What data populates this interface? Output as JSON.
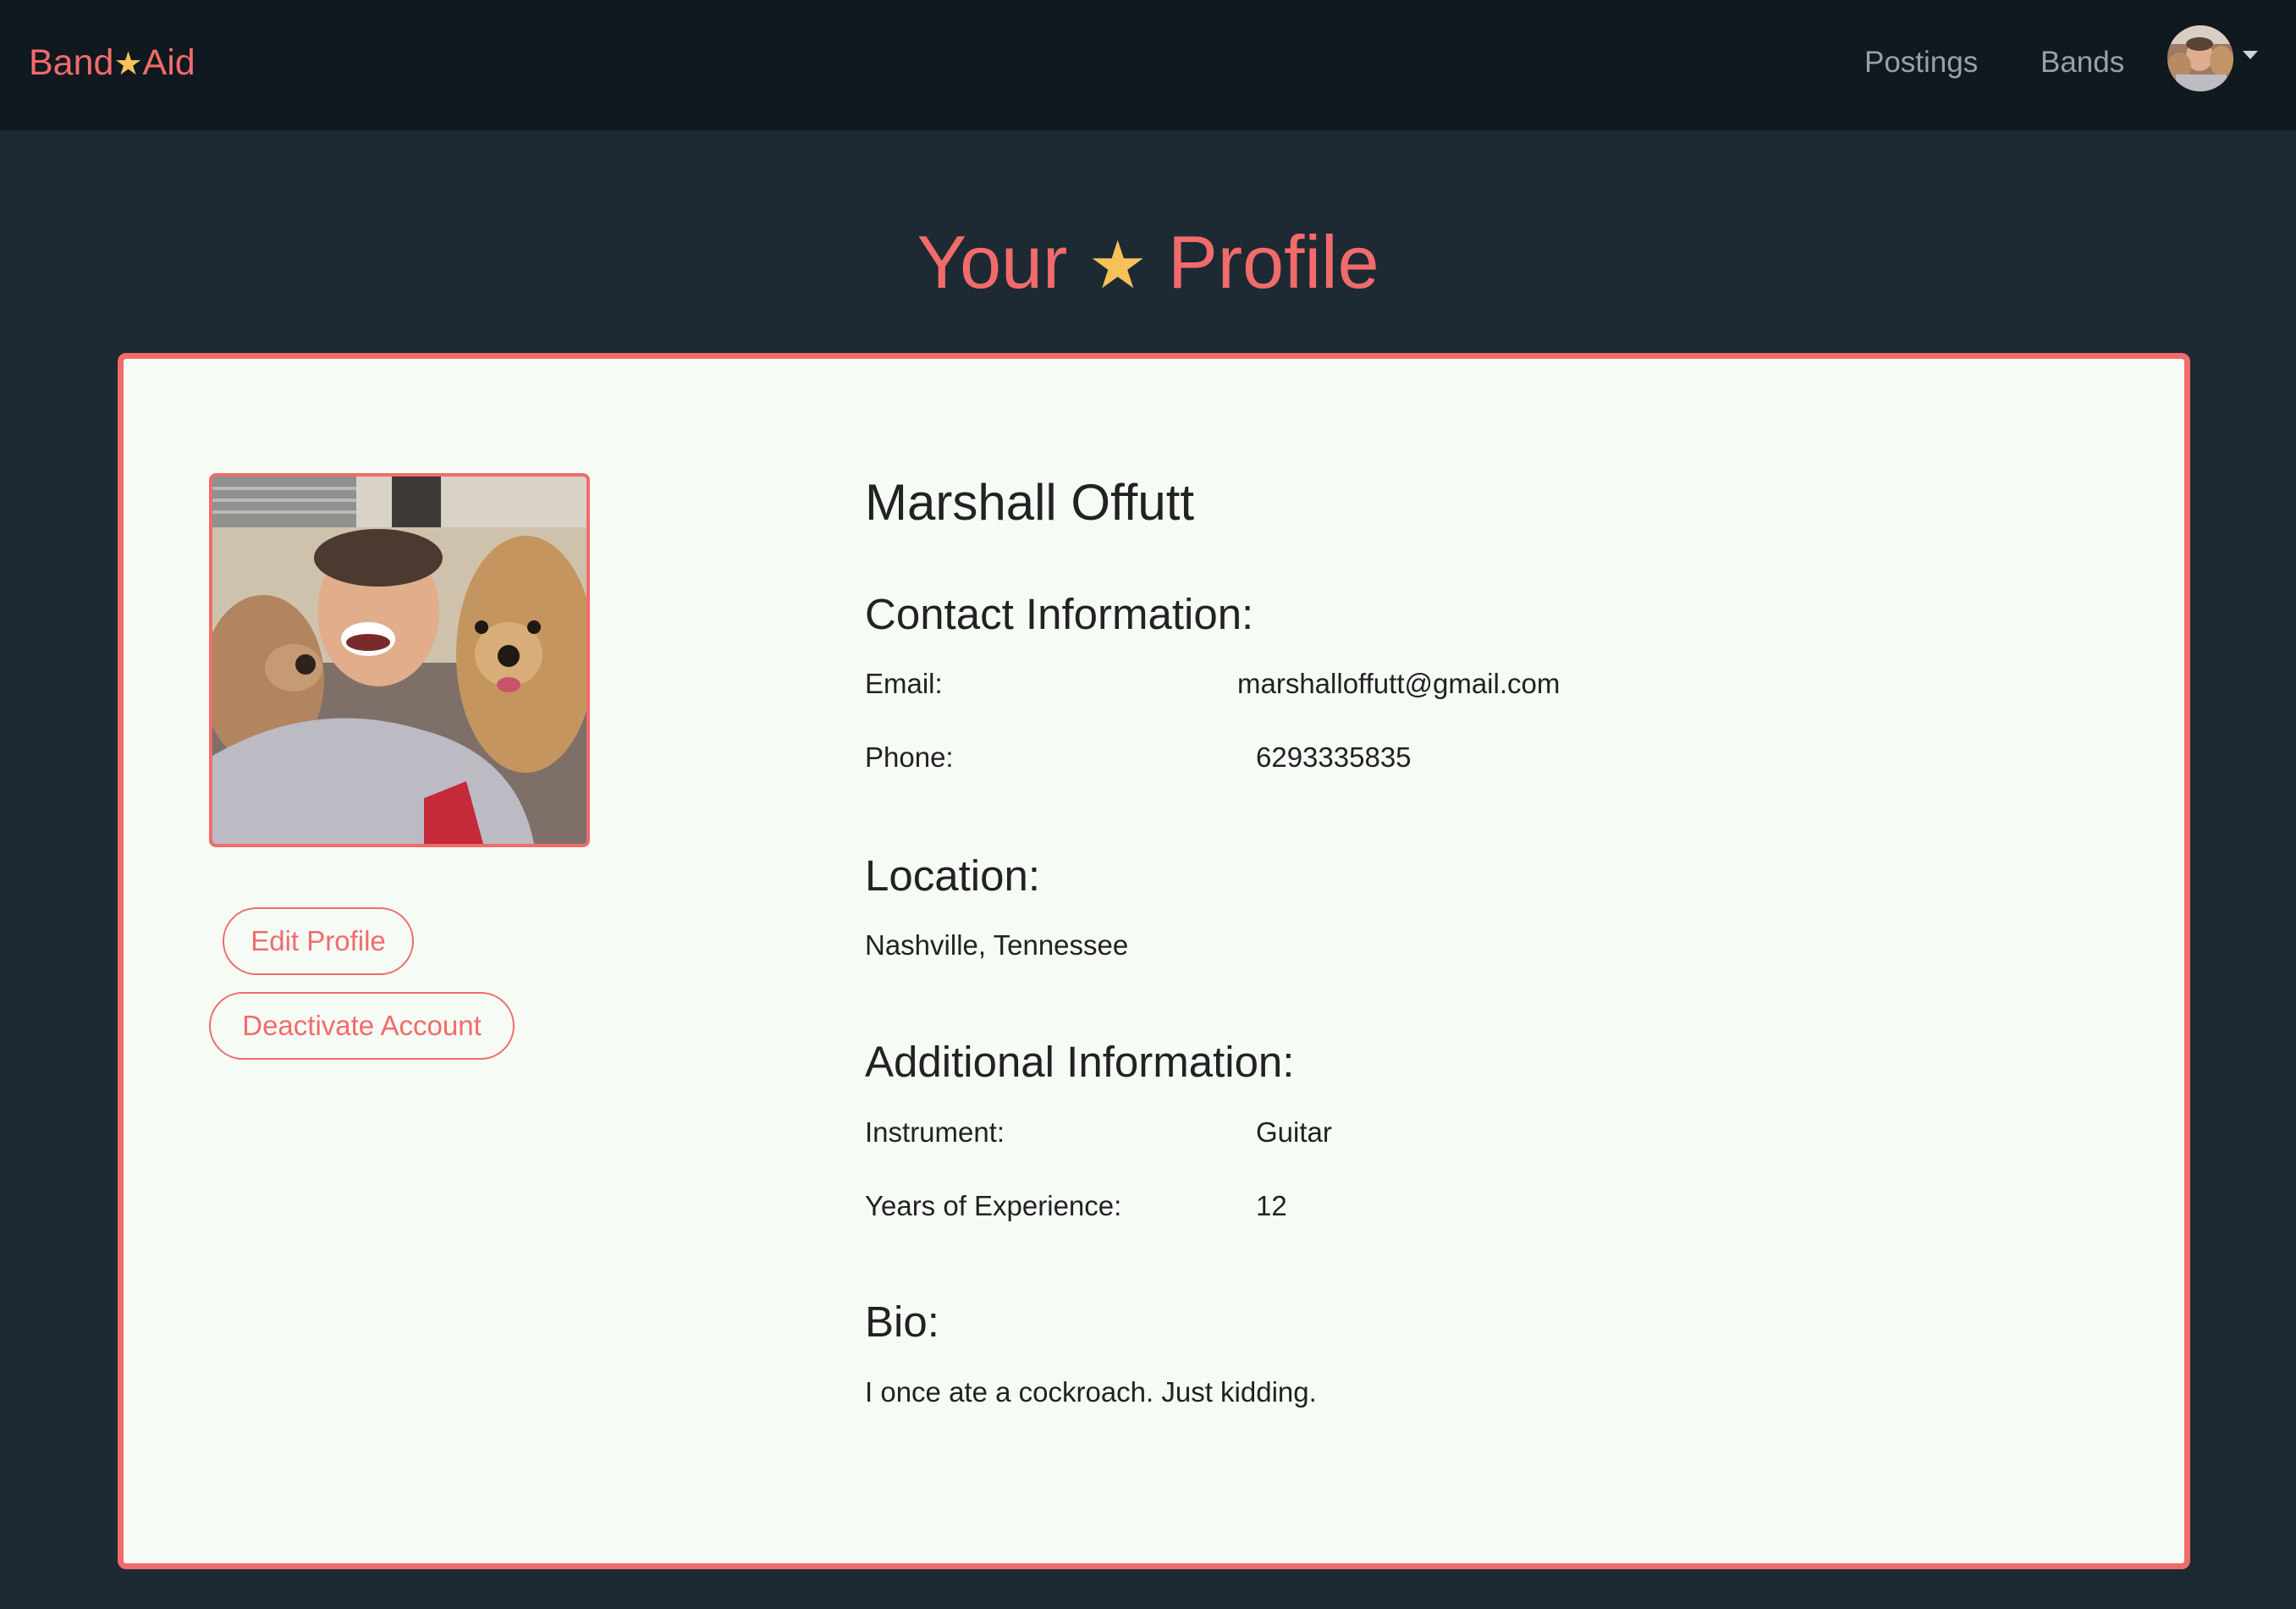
{
  "nav": {
    "brand_left": "Band",
    "brand_star": "★",
    "brand_right": "Aid",
    "links": [
      "Postings",
      "Bands"
    ]
  },
  "page": {
    "title_left": "Your",
    "title_star": "★",
    "title_right": "Profile"
  },
  "profile": {
    "name": "Marshall Offutt",
    "buttons": {
      "edit": "Edit Profile",
      "deactivate": "Deactivate Account"
    },
    "contact": {
      "heading": "Contact Information:",
      "email_label": "Email:",
      "email_value": "marshalloffutt@gmail.com",
      "phone_label": "Phone:",
      "phone_value": "6293335835"
    },
    "location": {
      "heading": "Location:",
      "value": "Nashville, Tennessee"
    },
    "additional": {
      "heading": "Additional Information:",
      "instrument_label": "Instrument:",
      "instrument_value": "Guitar",
      "experience_label": "Years of Experience:",
      "experience_value": "12"
    },
    "bio": {
      "heading": "Bio:",
      "value": "I once ate a cockroach. Just kidding."
    }
  },
  "colors": {
    "accent": "#f26b6b",
    "star": "#f7c15a",
    "navbar_bg": "#101820",
    "page_bg": "#1d2a33",
    "card_bg": "#f6fcf5"
  },
  "icons": {
    "brand_star": "star-icon",
    "user_menu_caret": "caret-down-icon"
  }
}
